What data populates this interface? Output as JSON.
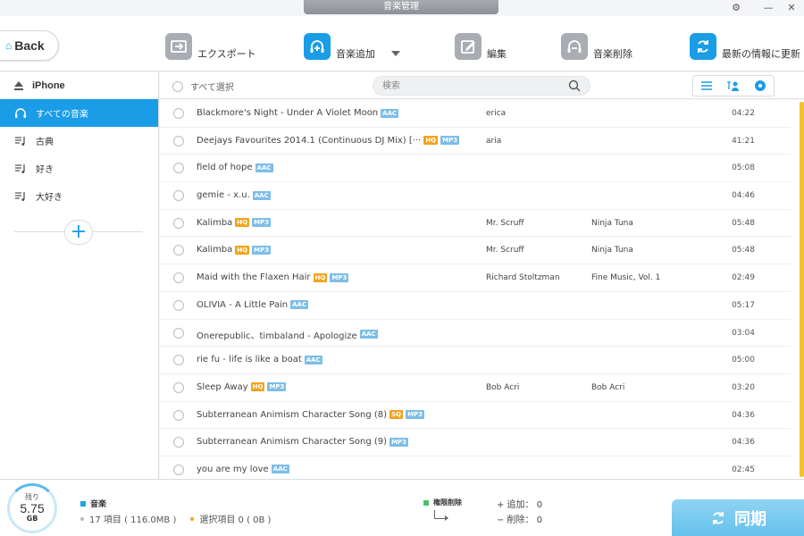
{
  "window": {
    "title": "音楽管理"
  },
  "toolbar": {
    "back_label": "Back",
    "export_label": "エクスポート",
    "add_label": "音楽追加",
    "edit_label": "編集",
    "delete_label": "音楽削除",
    "refresh_label": "最新の情報に更新"
  },
  "sidebar": {
    "device": "iPhone",
    "items": [
      {
        "label": "すべての音楽",
        "icon": "headphones-icon",
        "active": true
      },
      {
        "label": "古典",
        "icon": "playlist-icon"
      },
      {
        "label": "好き",
        "icon": "playlist-icon"
      },
      {
        "label": "大好き",
        "icon": "playlist-icon"
      }
    ]
  },
  "list_header": {
    "select_all": "すべて選択",
    "search_placeholder": "検索"
  },
  "tracks": [
    {
      "title": "Blackmore's Night - Under A Violet Moon",
      "badges": [
        "AAC"
      ],
      "artist": "erica",
      "album": "",
      "duration": "04:22"
    },
    {
      "title": "Deejays Favourites 2014.1 (Continuous DJ Mix) [···",
      "badges": [
        "HQ",
        "MP3"
      ],
      "artist": "aria",
      "album": "",
      "duration": "41:21"
    },
    {
      "title": "field of hope",
      "badges": [
        "AAC"
      ],
      "artist": "",
      "album": "",
      "duration": "05:08"
    },
    {
      "title": "gemie - x.u.",
      "badges": [
        "AAC"
      ],
      "artist": "",
      "album": "",
      "duration": "04:46"
    },
    {
      "title": "Kalimba",
      "badges": [
        "HQ",
        "MP3"
      ],
      "artist": "Mr. Scruff",
      "album": "Ninja Tuna",
      "duration": "05:48"
    },
    {
      "title": "Kalimba",
      "badges": [
        "HQ",
        "MP3"
      ],
      "artist": "Mr. Scruff",
      "album": "Ninja Tuna",
      "duration": "05:48"
    },
    {
      "title": "Maid with the Flaxen Hair",
      "badges": [
        "HQ",
        "MP3"
      ],
      "artist": "Richard Stoltzman",
      "album": "Fine Music, Vol. 1",
      "duration": "02:49"
    },
    {
      "title": "OLIVIA - A Little Pain",
      "badges": [
        "AAC"
      ],
      "artist": "",
      "album": "",
      "duration": "05:17"
    },
    {
      "title": "Onerepublic、timbaland - Apologize",
      "badges": [
        "AAC"
      ],
      "artist": "",
      "album": "",
      "duration": "03:04"
    },
    {
      "title": "rie fu - life is like a boat",
      "badges": [
        "AAC"
      ],
      "artist": "",
      "album": "",
      "duration": "05:00"
    },
    {
      "title": "Sleep Away",
      "badges": [
        "HQ",
        "MP3"
      ],
      "artist": "Bob Acri",
      "album": "Bob Acri",
      "duration": "03:20"
    },
    {
      "title": "Subterranean Animism Character Song (8)",
      "badges": [
        "SQ",
        "MP3"
      ],
      "artist": "",
      "album": "",
      "duration": "04:36"
    },
    {
      "title": "Subterranean Animism Character Song (9)",
      "badges": [
        "MP3"
      ],
      "artist": "",
      "album": "",
      "duration": "04:36"
    },
    {
      "title": "you are my love",
      "badges": [
        "AAC"
      ],
      "artist": "",
      "album": "",
      "duration": "02:45"
    }
  ],
  "footer": {
    "storage_label": "残り",
    "storage_value": "5.75",
    "storage_unit": "GB",
    "category": "音楽",
    "items_text": "17 項目 ( 116.0MB )",
    "selected_text": "選択項目 0 ( 0B )",
    "permission_label": "権限削除",
    "added_text": "+ 追加： 0",
    "removed_text": "− 削除： 0",
    "sync_label": "同期"
  },
  "colors": {
    "accent": "#1a9de6",
    "hq": "#f2a31c",
    "format": "#7dbde8",
    "scrollbar": "#f3c12a"
  }
}
